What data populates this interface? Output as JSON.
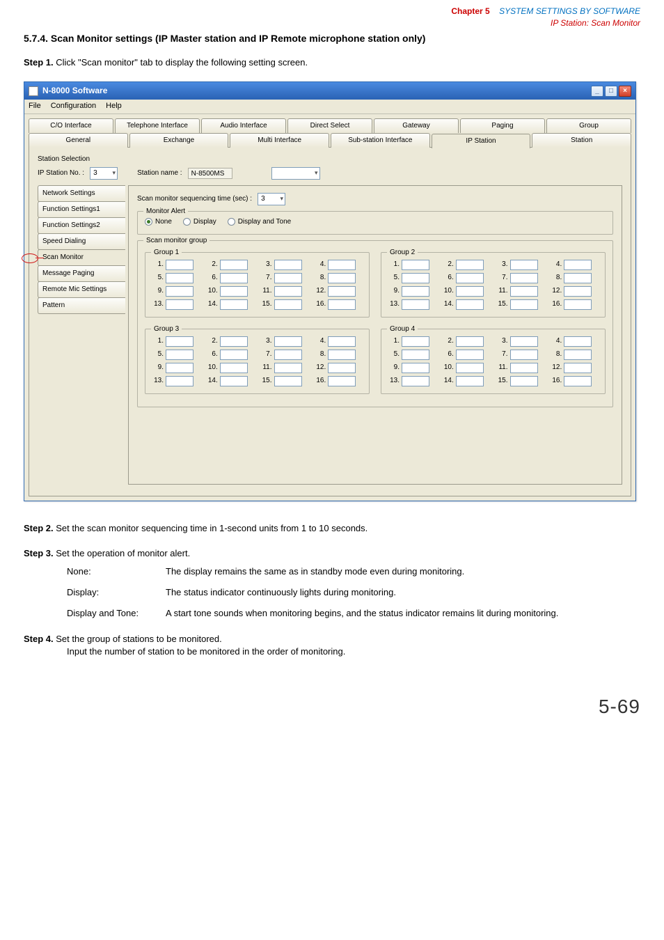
{
  "header": {
    "chapter_label": "Chapter 5",
    "chapter_title": "SYSTEM SETTINGS BY SOFTWARE",
    "sub": "IP Station: Scan Monitor"
  },
  "section_title": "5.7.4. Scan Monitor settings (IP Master station and IP Remote microphone station only)",
  "step1": {
    "label": "Step 1.",
    "text": "Click \"Scan monitor\" tab to display the following setting screen."
  },
  "window": {
    "title": "N-8000 Software",
    "menu": {
      "file": "File",
      "config": "Configuration",
      "help": "Help"
    },
    "tabs_top": {
      "co": "C/O Interface",
      "tel": "Telephone Interface",
      "audio": "Audio Interface",
      "direct": "Direct Select",
      "gateway": "Gateway",
      "paging": "Paging",
      "group": "Group"
    },
    "tabs_bottom": {
      "general": "General",
      "exchange": "Exchange",
      "multi": "Multi Interface",
      "sub": "Sub-station Interface",
      "ip": "IP Station",
      "station": "Station"
    },
    "station_selection": "Station Selection",
    "ip_station_no_label": "IP Station No. :",
    "ip_station_no_value": "3",
    "station_name_label": "Station name :",
    "station_name_value": "N-8500MS",
    "side_tabs": {
      "net": "Network Settings",
      "f1": "Function Settings1",
      "f2": "Function Settings2",
      "speed": "Speed Dialing",
      "scan": "Scan Monitor",
      "msg": "Message Paging",
      "remote": "Remote Mic Settings",
      "pattern": "Pattern"
    },
    "seq_label": "Scan monitor sequencing time (sec) :",
    "seq_value": "3",
    "monitor_alert_legend": "Monitor Alert",
    "alert_none": "None",
    "alert_display": "Display",
    "alert_tone": "Display and Tone",
    "group_legend": "Scan monitor group",
    "group_titles": {
      "g1": "Group 1",
      "g2": "Group 2",
      "g3": "Group 3",
      "g4": "Group 4"
    }
  },
  "step2": {
    "label": "Step 2.",
    "text": "Set the scan monitor sequencing time in 1-second units from 1 to 10 seconds."
  },
  "step3": {
    "label": "Step 3.",
    "text": "Set the operation of monitor alert.",
    "none_term": "None:",
    "none_desc": "The display remains the same as in standby mode even during monitoring.",
    "disp_term": "Display:",
    "disp_desc": "The status indicator continuously lights during monitoring.",
    "dt_term": "Display and Tone:",
    "dt_desc": "A start tone sounds when monitoring begins, and the status indicator remains lit during monitoring."
  },
  "step4": {
    "label": "Step 4.",
    "line1": "Set the group of stations to be monitored.",
    "line2": "Input the number of station to be monitored in the order of monitoring."
  },
  "page_number": "5-69"
}
